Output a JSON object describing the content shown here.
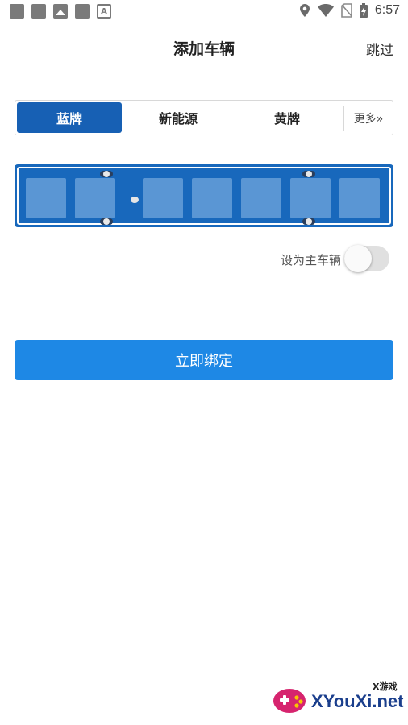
{
  "status_bar": {
    "time": "6:57",
    "left_icons": [
      "notification-square-icon",
      "notification-square-icon",
      "image-icon",
      "notification-square-icon",
      "text-a-icon"
    ],
    "right_icons": [
      "location-pin-icon",
      "wifi-icon",
      "no-sim-icon",
      "battery-charging-icon"
    ]
  },
  "header": {
    "title": "添加车辆",
    "skip_label": "跳过"
  },
  "plate_tabs": {
    "items": [
      {
        "label": "蓝牌",
        "active": true
      },
      {
        "label": "新能源",
        "active": false
      },
      {
        "label": "黄牌",
        "active": false
      }
    ],
    "more_label": "更多»"
  },
  "plate_input": {
    "cell_count": 7,
    "values": [
      "",
      "",
      "",
      "",
      "",
      "",
      ""
    ],
    "plate_color": "#1868bc"
  },
  "primary_vehicle": {
    "label": "设为主车辆",
    "enabled": false
  },
  "bind_button": {
    "label": "立即绑定",
    "color": "#1e88e5"
  },
  "watermark": {
    "text": "XYouXi.net",
    "sub": "X游戏"
  }
}
